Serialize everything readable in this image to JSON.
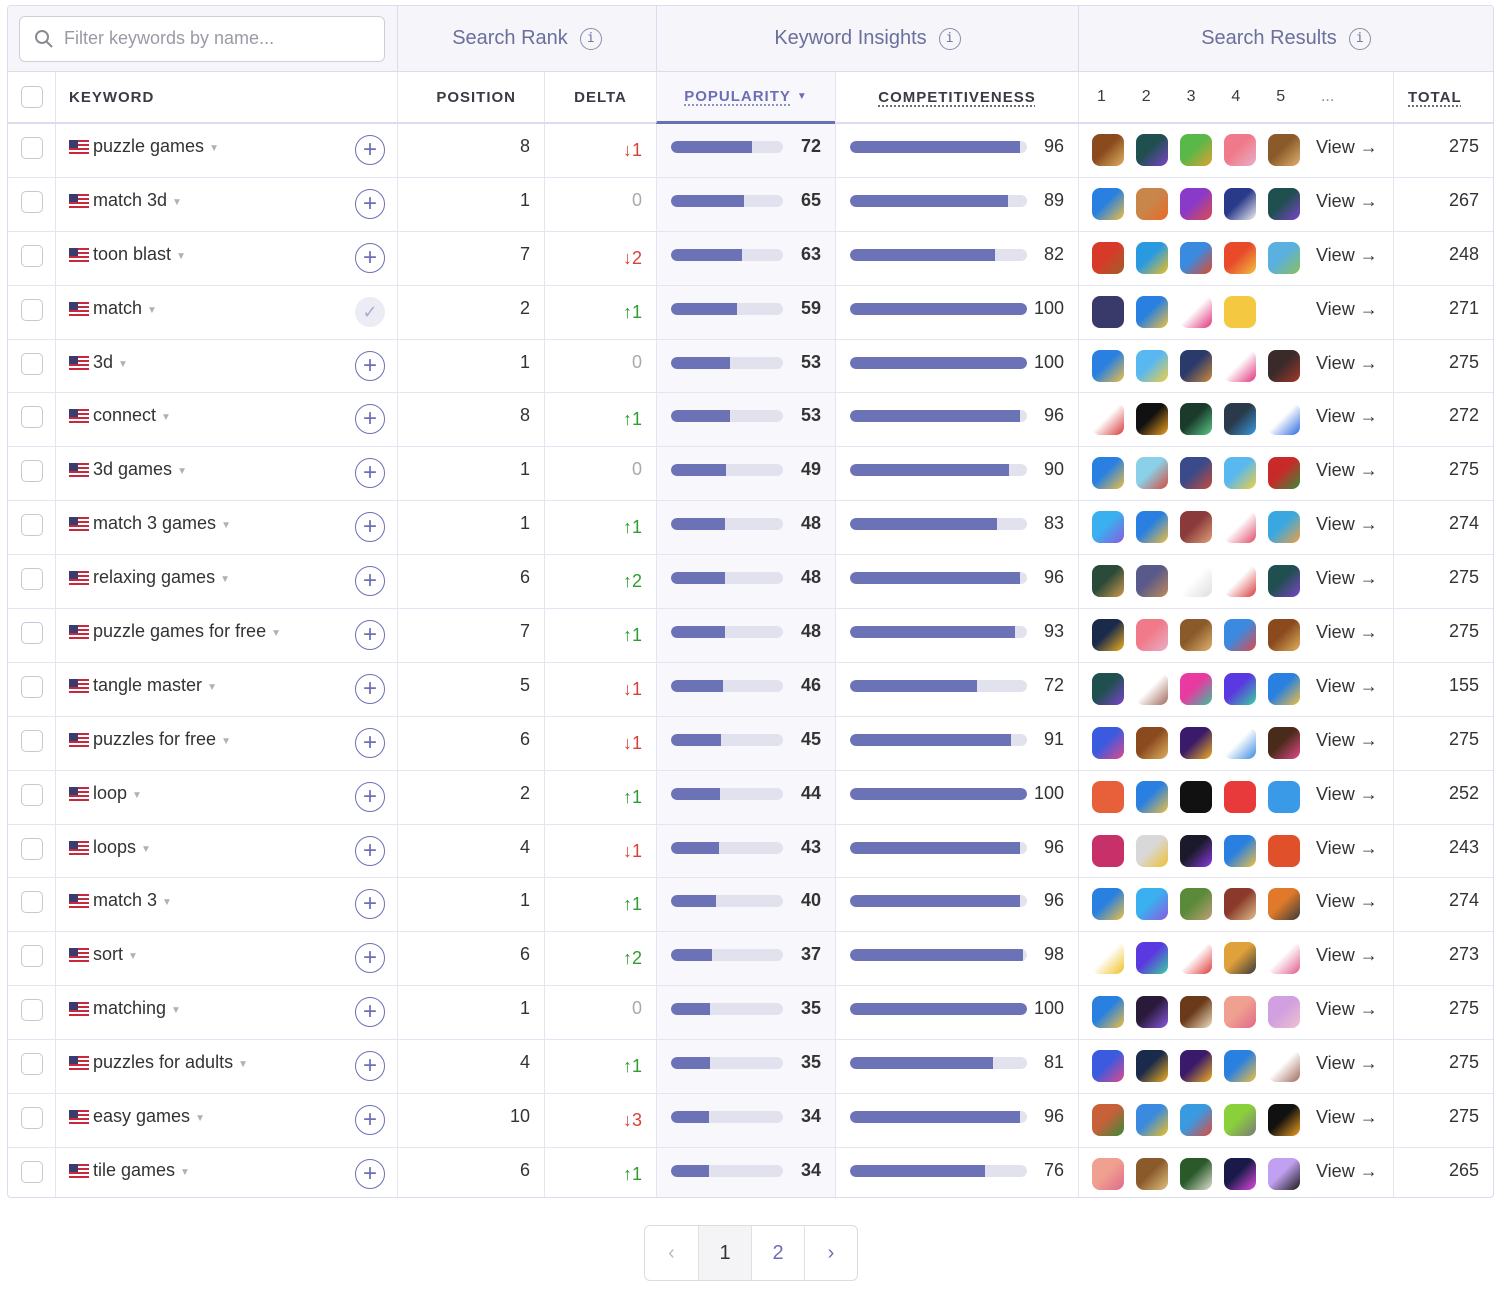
{
  "filter": {
    "placeholder": "Filter keywords by name..."
  },
  "group_headers": {
    "search_rank": "Search Rank",
    "keyword_insights": "Keyword Insights",
    "search_results": "Search Results",
    "info_glyph": "i"
  },
  "columns": {
    "keyword": "KEYWORD",
    "position": "POSITION",
    "delta": "DELTA",
    "popularity": "POPULARITY",
    "competitiveness": "COMPETITIVENESS",
    "ranks": [
      "1",
      "2",
      "3",
      "4",
      "5",
      "..."
    ],
    "total": "TOTAL",
    "sorted_by": "popularity",
    "sort_direction": "desc"
  },
  "view_label": "View →",
  "rows": [
    {
      "keyword": "puzzle games",
      "tracked": false,
      "position": "8",
      "delta": {
        "dir": "down",
        "text": "↓1"
      },
      "popularity": 72,
      "competitiveness": 96,
      "total": "275",
      "apps": [
        {
          "name": "jigsaw-puzzle",
          "colors": [
            "#8a4a1e",
            "#e0b060"
          ]
        },
        {
          "name": "tangle-master",
          "colors": [
            "#1f4f4f",
            "#7a45c8"
          ]
        },
        {
          "name": "pull-pin",
          "colors": [
            "#58b848",
            "#e0a030"
          ]
        },
        {
          "name": "word-game",
          "colors": [
            "#f07a8a",
            "#e8b0c8"
          ]
        },
        {
          "name": "wood-block",
          "colors": [
            "#8a5a2a",
            "#e0b070"
          ]
        }
      ]
    },
    {
      "keyword": "match 3d",
      "tracked": false,
      "position": "1",
      "delta": {
        "dir": "zero",
        "text": "0"
      },
      "popularity": 65,
      "competitiveness": 89,
      "total": "267",
      "apps": [
        {
          "name": "hole-game",
          "colors": [
            "#2a80e0",
            "#f0c040"
          ]
        },
        {
          "name": "carrot-match",
          "colors": [
            "#c8864a",
            "#e86a2a"
          ]
        },
        {
          "name": "fruit-slice",
          "colors": [
            "#8a3ac8",
            "#e04a4a"
          ]
        },
        {
          "name": "cat-game",
          "colors": [
            "#2a3a8a",
            "#f0f0f0"
          ]
        },
        {
          "name": "tangle-master",
          "colors": [
            "#1f4f4f",
            "#7a45c8"
          ]
        }
      ]
    },
    {
      "keyword": "toon blast",
      "tracked": false,
      "position": "7",
      "delta": {
        "dir": "down",
        "text": "↓2"
      },
      "popularity": 63,
      "competitiveness": 82,
      "total": "248",
      "apps": [
        {
          "name": "bear-game",
          "colors": [
            "#d83a2a",
            "#a0602a"
          ]
        },
        {
          "name": "toy-blast",
          "colors": [
            "#2a9ae0",
            "#f0c020"
          ]
        },
        {
          "name": "candy-crush",
          "colors": [
            "#3a8ae0",
            "#e04a2a"
          ]
        },
        {
          "name": "block-blast",
          "colors": [
            "#e84a2a",
            "#f0c040"
          ]
        },
        {
          "name": "home-design",
          "colors": [
            "#5ab0e0",
            "#8ac05a"
          ]
        }
      ]
    },
    {
      "keyword": "match",
      "tracked": true,
      "position": "2",
      "delta": {
        "dir": "up",
        "text": "↑1"
      },
      "popularity": 59,
      "competitiveness": 100,
      "total": "271",
      "apps": [
        {
          "name": "match-dating",
          "colors": [
            "#3a3a6a",
            "#3a3a6a"
          ]
        },
        {
          "name": "hole-game",
          "colors": [
            "#2a80e0",
            "#f0c040"
          ]
        },
        {
          "name": "fish-logo",
          "colors": [
            "#ffffff",
            "#e0307a"
          ]
        },
        {
          "name": "bumble",
          "colors": [
            "#f5c842",
            "#f5c842"
          ]
        },
        {
          "name": "hinge",
          "colors": [
            "#ffffff",
            "#ffffff"
          ]
        }
      ]
    },
    {
      "keyword": "3d",
      "tracked": false,
      "position": "1",
      "delta": {
        "dir": "zero",
        "text": "0"
      },
      "popularity": 53,
      "competitiveness": 100,
      "total": "275",
      "apps": [
        {
          "name": "hole-game",
          "colors": [
            "#2a80e0",
            "#f0c040"
          ]
        },
        {
          "name": "stack-3d",
          "colors": [
            "#5ab8f0",
            "#f0d040"
          ]
        },
        {
          "name": "hero-game",
          "colors": [
            "#2a3a6a",
            "#d08a3a"
          ]
        },
        {
          "name": "dash-game",
          "colors": [
            "#ffffff",
            "#e0307a"
          ]
        },
        {
          "name": "scary-teacher",
          "colors": [
            "#3a2a2a",
            "#a03a2a"
          ]
        }
      ]
    },
    {
      "keyword": "connect",
      "tracked": false,
      "position": "8",
      "delta": {
        "dir": "up",
        "text": "↑1"
      },
      "popularity": 53,
      "competitiveness": 96,
      "total": "272",
      "apps": [
        {
          "name": "connected",
          "colors": [
            "#ffffff",
            "#d83a3a"
          ]
        },
        {
          "name": "flow-free",
          "colors": [
            "#111111",
            "#f0a020"
          ]
        },
        {
          "name": "connect-app",
          "colors": [
            "#1a3a2a",
            "#5ac88a"
          ]
        },
        {
          "name": "garmin-connect",
          "colors": [
            "#2a3a4a",
            "#3a9ae0"
          ]
        },
        {
          "name": "meta-infinity",
          "colors": [
            "#ffffff",
            "#2a6ae0"
          ]
        }
      ]
    },
    {
      "keyword": "3d games",
      "tracked": false,
      "position": "1",
      "delta": {
        "dir": "zero",
        "text": "0"
      },
      "popularity": 49,
      "competitiveness": 90,
      "total": "275",
      "apps": [
        {
          "name": "hole-game",
          "colors": [
            "#2a80e0",
            "#f0c040"
          ]
        },
        {
          "name": "run-race",
          "colors": [
            "#8ad0e8",
            "#d84a3a"
          ]
        },
        {
          "name": "arcade-game",
          "colors": [
            "#3a4a8a",
            "#c84a3a"
          ]
        },
        {
          "name": "stack-3d",
          "colors": [
            "#5ab8f0",
            "#f0d040"
          ]
        },
        {
          "name": "xmas-tree",
          "colors": [
            "#c82a2a",
            "#3a8a3a"
          ]
        }
      ]
    },
    {
      "keyword": "match 3 games",
      "tracked": false,
      "position": "1",
      "delta": {
        "dir": "up",
        "text": "↑1"
      },
      "popularity": 48,
      "competitiveness": 83,
      "total": "274",
      "apps": [
        {
          "name": "bejeweled",
          "colors": [
            "#3ab0f0",
            "#8a5ae0"
          ]
        },
        {
          "name": "hole-game",
          "colors": [
            "#2a80e0",
            "#f0c040"
          ]
        },
        {
          "name": "story-game",
          "colors": [
            "#8a3a3a",
            "#e0a07a"
          ]
        },
        {
          "name": "cake-blast",
          "colors": [
            "#ffffff",
            "#e04a6a"
          ]
        },
        {
          "name": "fruit-match",
          "colors": [
            "#3aa8e0",
            "#f0a040"
          ]
        }
      ]
    },
    {
      "keyword": "relaxing games",
      "tracked": false,
      "position": "6",
      "delta": {
        "dir": "up",
        "text": "↑2"
      },
      "popularity": 48,
      "competitiveness": 96,
      "total": "275",
      "apps": [
        {
          "name": "sand-art",
          "colors": [
            "#2a4a3a",
            "#d09a4a"
          ]
        },
        {
          "name": "tree-island",
          "colors": [
            "#5a5a8a",
            "#c08a5a"
          ]
        },
        {
          "name": "asmr-hand",
          "colors": [
            "#ffffff",
            "#dddddd"
          ]
        },
        {
          "name": "lips-game",
          "colors": [
            "#ffffff",
            "#d83a3a"
          ]
        },
        {
          "name": "tangle-master",
          "colors": [
            "#1f4f4f",
            "#7a45c8"
          ]
        }
      ]
    },
    {
      "keyword": "puzzle games for free",
      "tracked": false,
      "position": "7",
      "delta": {
        "dir": "up",
        "text": "↑1"
      },
      "popularity": 48,
      "competitiveness": 93,
      "total": "275",
      "apps": [
        {
          "name": "jigsaw-dark",
          "colors": [
            "#1a2a4a",
            "#f0b020"
          ]
        },
        {
          "name": "word-game",
          "colors": [
            "#f07a8a",
            "#e8b0c8"
          ]
        },
        {
          "name": "wood-block",
          "colors": [
            "#8a5a2a",
            "#e0b070"
          ]
        },
        {
          "name": "pin-rescue",
          "colors": [
            "#3a8ae0",
            "#e04a4a"
          ]
        },
        {
          "name": "jigsaw-puzzle",
          "colors": [
            "#8a4a1e",
            "#e0b060"
          ]
        }
      ]
    },
    {
      "keyword": "tangle master",
      "tracked": false,
      "position": "5",
      "delta": {
        "dir": "down",
        "text": "↓1"
      },
      "popularity": 46,
      "competitiveness": 72,
      "total": "155",
      "apps": [
        {
          "name": "tangle-master",
          "colors": [
            "#1f4f4f",
            "#7a45c8"
          ]
        },
        {
          "name": "brain-test",
          "colors": [
            "#ffffff",
            "#a06a5a"
          ]
        },
        {
          "name": "rope-twist",
          "colors": [
            "#e83aa0",
            "#3ac0a0"
          ]
        },
        {
          "name": "ball-sort",
          "colors": [
            "#5a3ae0",
            "#3ad0a0"
          ]
        },
        {
          "name": "hole-game",
          "colors": [
            "#2a80e0",
            "#f0c040"
          ]
        }
      ]
    },
    {
      "keyword": "puzzles for free",
      "tracked": false,
      "position": "6",
      "delta": {
        "dir": "down",
        "text": "↓1"
      },
      "popularity": 45,
      "competitiveness": 91,
      "total": "275",
      "apps": [
        {
          "name": "jigsaw-2021",
          "colors": [
            "#3a5ae0",
            "#e04a8a"
          ]
        },
        {
          "name": "jigsaw-puzzle",
          "colors": [
            "#8a4a1e",
            "#e0b060"
          ]
        },
        {
          "name": "jigsaw-dark",
          "colors": [
            "#3a1a6a",
            "#f0b020"
          ]
        },
        {
          "name": "word-search",
          "colors": [
            "#ffffff",
            "#3a8ae0"
          ]
        },
        {
          "name": "color-puzzle",
          "colors": [
            "#4a2a1a",
            "#e04a8a"
          ]
        }
      ]
    },
    {
      "keyword": "loop",
      "tracked": false,
      "position": "2",
      "delta": {
        "dir": "up",
        "text": "↑1"
      },
      "popularity": 44,
      "competitiveness": 100,
      "total": "252",
      "apps": [
        {
          "name": "infinity-loop",
          "colors": [
            "#e8603a",
            "#e8603a"
          ]
        },
        {
          "name": "hole-game",
          "colors": [
            "#2a80e0",
            "#f0c040"
          ]
        },
        {
          "name": "loop-black",
          "colors": [
            "#111111",
            "#111111"
          ]
        },
        {
          "name": "loop-red",
          "colors": [
            "#e83a3a",
            "#e83a3a"
          ]
        },
        {
          "name": "sync-loop",
          "colors": [
            "#3a9ae8",
            "#3a9ae8"
          ]
        }
      ]
    },
    {
      "keyword": "loops",
      "tracked": false,
      "position": "4",
      "delta": {
        "dir": "down",
        "text": "↓1"
      },
      "popularity": 43,
      "competitiveness": 96,
      "total": "243",
      "apps": [
        {
          "name": "loops-pink",
          "colors": [
            "#c8306a",
            "#c8306a"
          ]
        },
        {
          "name": "loop-yellow",
          "colors": [
            "#d8d8d8",
            "#f0c030"
          ]
        },
        {
          "name": "link-purple",
          "colors": [
            "#1a1a2a",
            "#8a3ae0"
          ]
        },
        {
          "name": "hole-game",
          "colors": [
            "#2a80e0",
            "#f0c040"
          ]
        },
        {
          "name": "music-lab",
          "colors": [
            "#e0502a",
            "#e0502a"
          ]
        }
      ]
    },
    {
      "keyword": "match 3",
      "tracked": false,
      "position": "1",
      "delta": {
        "dir": "up",
        "text": "↑1"
      },
      "popularity": 40,
      "competitiveness": 96,
      "total": "274",
      "apps": [
        {
          "name": "hole-game",
          "colors": [
            "#2a80e0",
            "#f0c040"
          ]
        },
        {
          "name": "bejeweled",
          "colors": [
            "#3ab0f0",
            "#8a5ae0"
          ]
        },
        {
          "name": "army-game",
          "colors": [
            "#5a8a3a",
            "#c0a07a"
          ]
        },
        {
          "name": "wizard-game",
          "colors": [
            "#8a3a2a",
            "#e0c08a"
          ]
        },
        {
          "name": "sword-game",
          "colors": [
            "#e07a2a",
            "#3a3a3a"
          ]
        }
      ]
    },
    {
      "keyword": "sort",
      "tracked": false,
      "position": "6",
      "delta": {
        "dir": "up",
        "text": "↑2"
      },
      "popularity": 37,
      "competitiveness": 98,
      "total": "273",
      "apps": [
        {
          "name": "water-sort",
          "colors": [
            "#ffffff",
            "#f0c020"
          ]
        },
        {
          "name": "ball-sort",
          "colors": [
            "#5a3ae0",
            "#3ad0a0"
          ]
        },
        {
          "name": "ball-sort-tubes",
          "colors": [
            "#ffffff",
            "#e03a3a"
          ]
        },
        {
          "name": "sort-box",
          "colors": [
            "#e0a03a",
            "#3a3a3a"
          ]
        },
        {
          "name": "color-tubes",
          "colors": [
            "#ffffff",
            "#e05a8a"
          ]
        }
      ]
    },
    {
      "keyword": "matching",
      "tracked": false,
      "position": "1",
      "delta": {
        "dir": "zero",
        "text": "0"
      },
      "popularity": 35,
      "competitiveness": 100,
      "total": "275",
      "apps": [
        {
          "name": "hole-game",
          "colors": [
            "#2a80e0",
            "#f0c040"
          ]
        },
        {
          "name": "neon-puzzle",
          "colors": [
            "#2a1a3a",
            "#8a5ae0"
          ]
        },
        {
          "name": "mahjong",
          "colors": [
            "#6a3a1a",
            "#f0e0c0"
          ]
        },
        {
          "name": "tile-avocado",
          "colors": [
            "#f0a090",
            "#e06a8a"
          ]
        },
        {
          "name": "tile-match",
          "colors": [
            "#d0a0e0",
            "#f0c0d0"
          ]
        }
      ]
    },
    {
      "keyword": "puzzles for adults",
      "tracked": false,
      "position": "4",
      "delta": {
        "dir": "up",
        "text": "↑1"
      },
      "popularity": 35,
      "competitiveness": 81,
      "total": "275",
      "apps": [
        {
          "name": "jigsaw-2021",
          "colors": [
            "#3a5ae0",
            "#e04a8a"
          ]
        },
        {
          "name": "jigsaw-dark",
          "colors": [
            "#1a2a4a",
            "#f0b020"
          ]
        },
        {
          "name": "jigsaw-purple",
          "colors": [
            "#3a1a6a",
            "#f0b020"
          ]
        },
        {
          "name": "hole-game",
          "colors": [
            "#2a80e0",
            "#f0c040"
          ]
        },
        {
          "name": "brain-test",
          "colors": [
            "#ffffff",
            "#a06a5a"
          ]
        }
      ]
    },
    {
      "keyword": "easy games",
      "tracked": false,
      "position": "10",
      "delta": {
        "dir": "down",
        "text": "↓3"
      },
      "popularity": 34,
      "competitiveness": 96,
      "total": "275",
      "apps": [
        {
          "name": "fruit-ninja",
          "colors": [
            "#c8603a",
            "#3a8a3a"
          ]
        },
        {
          "name": "cube-sort",
          "colors": [
            "#3a8ae0",
            "#f0c020"
          ]
        },
        {
          "name": "boy-game",
          "colors": [
            "#3a9ae0",
            "#e04a3a"
          ]
        },
        {
          "name": "talking-tom",
          "colors": [
            "#8ad03a",
            "#7a7a7a"
          ]
        },
        {
          "name": "flow-free",
          "colors": [
            "#111111",
            "#f0a020"
          ]
        }
      ]
    },
    {
      "keyword": "tile games",
      "tracked": false,
      "position": "6",
      "delta": {
        "dir": "up",
        "text": "↑1"
      },
      "popularity": 34,
      "competitiveness": 76,
      "total": "265",
      "apps": [
        {
          "name": "tile-avocado",
          "colors": [
            "#f0a090",
            "#e06a8a"
          ]
        },
        {
          "name": "tile-connect",
          "colors": [
            "#8a5a2a",
            "#e0c080"
          ]
        },
        {
          "name": "mahjong-green",
          "colors": [
            "#2a5a2a",
            "#e0e0d0"
          ]
        },
        {
          "name": "tiles-hop",
          "colors": [
            "#1a1a4a",
            "#e04ae0"
          ]
        },
        {
          "name": "piano-tiles",
          "colors": [
            "#c0a0f0",
            "#1a1a1a"
          ]
        }
      ]
    }
  ],
  "pagination": {
    "prev_glyph": "‹",
    "pages": [
      "1",
      "2"
    ],
    "current": "1",
    "next_glyph": "›"
  }
}
